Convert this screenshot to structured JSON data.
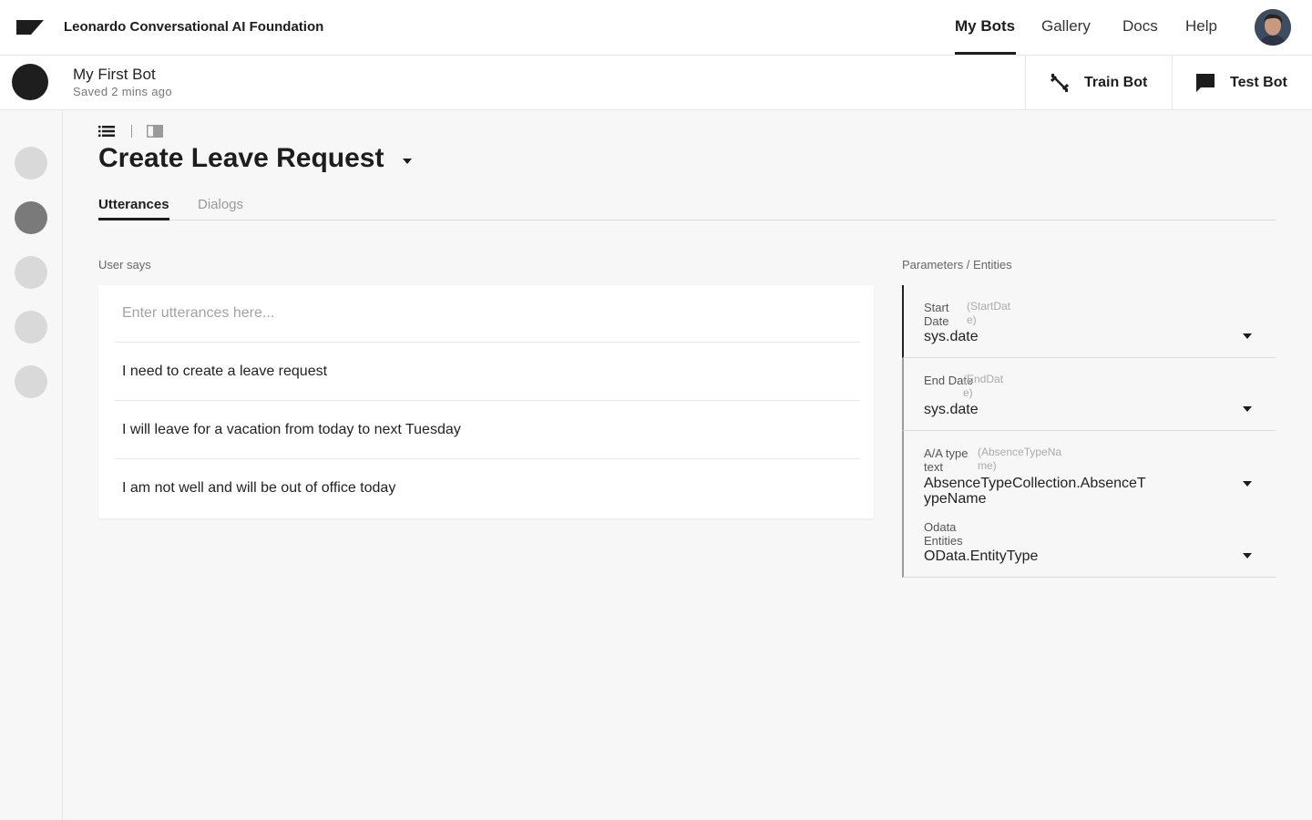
{
  "header": {
    "brand": "Leonardo Conversational AI Foundation",
    "nav": [
      {
        "label": "My Bots",
        "active": true
      },
      {
        "label": "Gallery",
        "active": false
      },
      {
        "label": "Docs",
        "active": false
      },
      {
        "label": "Help",
        "active": false
      }
    ]
  },
  "bot": {
    "name": "My First Bot",
    "saved": "Saved 2 mins ago",
    "train_label": "Train Bot",
    "test_label": "Test Bot"
  },
  "main": {
    "title": "Create Leave Request",
    "tabs": [
      {
        "label": "Utterances",
        "active": true
      },
      {
        "label": "Dialogs",
        "active": false
      }
    ],
    "user_says_label": "User says",
    "utterance_placeholder": "Enter utterances here...",
    "utterances": [
      "I need to create a leave request",
      "I will leave for a vacation from today to next Tuesday",
      "I am not well and will be out of office today"
    ],
    "params_label": "Parameters / Entities",
    "parameters": [
      {
        "name": "Start Date",
        "variable": "(StartDate)",
        "type": "sys.date"
      },
      {
        "name": "End Date",
        "variable": "(EndDate)",
        "type": "sys.date"
      },
      {
        "name": "A/A type text",
        "variable": "(AbsenceTypeName)",
        "type": "AbsenceTypeCollection.AbsenceTypeName"
      },
      {
        "name": "Odata Entities",
        "variable": "",
        "type": "OData.EntityType"
      }
    ]
  },
  "colors": {
    "accent": "#1d1d1d",
    "rail_active": "#7a7a7a",
    "rail_inactive": "#d9d9d9"
  }
}
